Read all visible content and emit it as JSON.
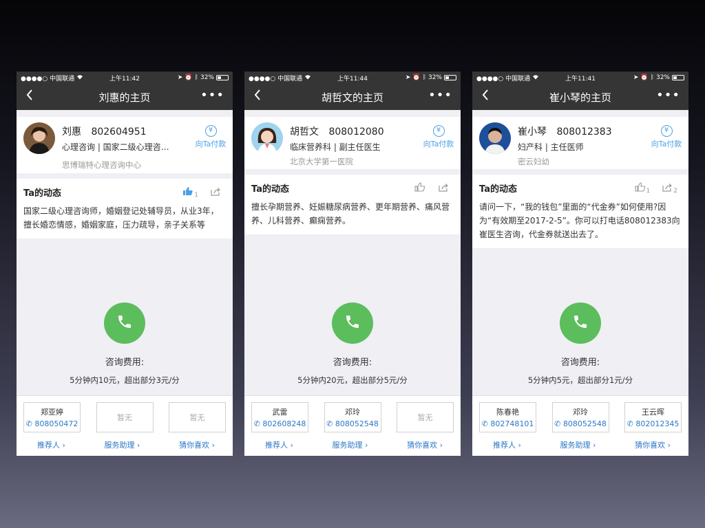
{
  "status_bar": {
    "carrier": "●●●●○ 中国联通",
    "battery": "32%"
  },
  "screens": [
    {
      "time": "上午11:42",
      "title": "刘惠的主页",
      "name": "刘惠",
      "number": "802604951",
      "title_line": "心理咨询 | 国家二级心理咨…",
      "org": "思博瑞特心理咨询中心",
      "pay_label": "向Ta付款",
      "dyn_title": "Ta的动态",
      "like_count": "1",
      "share_count": "",
      "dyn_text": "国家二级心理咨询师，婚姻登记处辅导员，从业3年，擅长婚恋情感，婚姻家庭，压力疏导，亲子关系等",
      "fee_label": "咨询费用:",
      "fee_value": "5分钟内10元，超出部分3元/分",
      "cards": [
        {
          "name": "郑亚婷",
          "phone": "808050472"
        },
        {
          "name": "",
          "phone": "",
          "empty": "暂无"
        },
        {
          "name": "",
          "phone": "",
          "empty": "暂无"
        }
      ]
    },
    {
      "time": "上午11:44",
      "title": "胡哲文的主页",
      "name": "胡哲文",
      "number": "808012080",
      "title_line": "临床营养科 | 副主任医生",
      "org": "北京大学第一医院",
      "pay_label": "向Ta付款",
      "dyn_title": "Ta的动态",
      "like_count": "",
      "share_count": "",
      "dyn_text": "擅长孕期营养、妊娠糖尿病营养、更年期营养、痛风营养、儿科营养、癫痫营养。",
      "fee_label": "咨询费用:",
      "fee_value": "5分钟内20元，超出部分5元/分",
      "cards": [
        {
          "name": "武雷",
          "phone": "802608248"
        },
        {
          "name": "邓玲",
          "phone": "808052548"
        },
        {
          "name": "",
          "phone": "",
          "empty": "暂无"
        }
      ]
    },
    {
      "time": "上午11:41",
      "title": "崔小琴的主页",
      "name": "崔小琴",
      "number": "808012383",
      "title_line": "妇产科 | 主任医师",
      "org": "密云妇幼",
      "pay_label": "向Ta付款",
      "dyn_title": "Ta的动态",
      "like_count": "1",
      "share_count": "2",
      "dyn_text": "请问一下，“我的钱包”里面的“代金券”如何使用?因为“有效期至2017-2-5”。你可以打电话808012383向崔医生咨询，代金券就送出去了。",
      "fee_label": "咨询费用:",
      "fee_value": "5分钟内5元，超出部分1元/分",
      "cards": [
        {
          "name": "陈春艳",
          "phone": "802748101"
        },
        {
          "name": "邓玲",
          "phone": "808052548"
        },
        {
          "name": "王云晖",
          "phone": "802012345"
        }
      ]
    }
  ],
  "links": {
    "recommender": "推荐人 ›",
    "assistant": "服务助理 ›",
    "guess": "猜你喜欢 ›"
  },
  "colors": {
    "navbar": "#353535",
    "accent_blue": "#4a9fe8",
    "call_green": "#5cbd5d"
  }
}
